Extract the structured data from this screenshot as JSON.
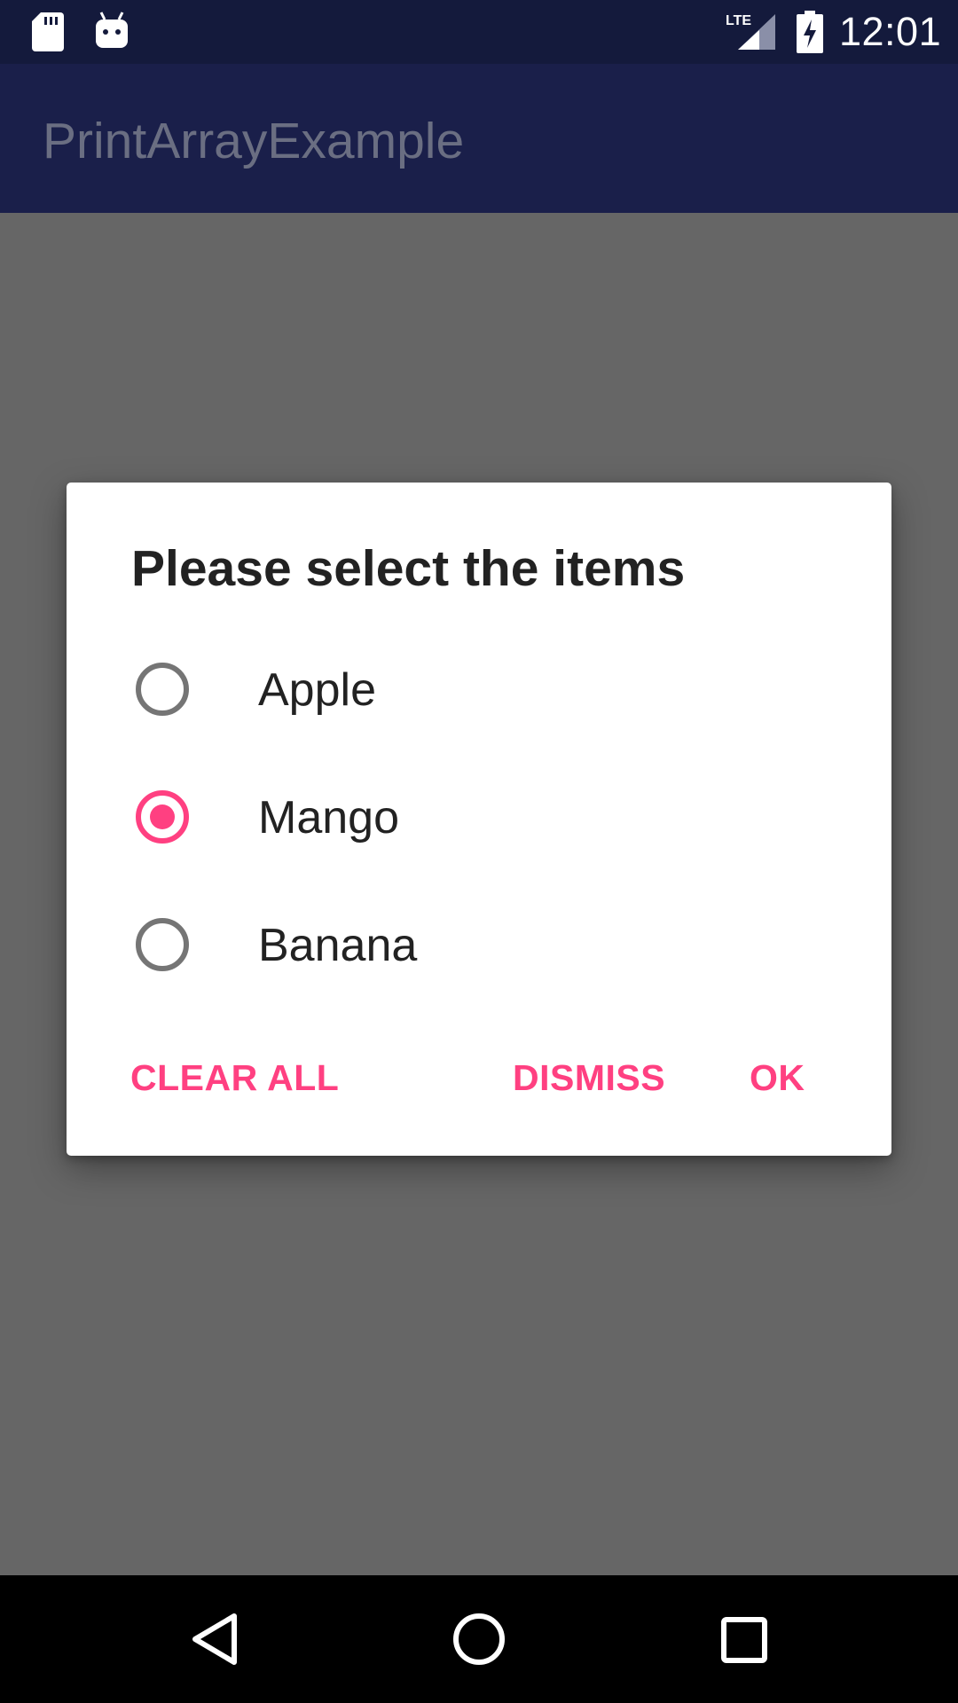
{
  "status_bar": {
    "time": "12:01",
    "network_label": "LTE",
    "icons": [
      "sd-card-icon",
      "android-icon",
      "lte-signal-icon",
      "battery-charging-icon"
    ]
  },
  "app_bar": {
    "title": "PrintArrayExample"
  },
  "dialog": {
    "title": "Please select the items",
    "options": [
      {
        "label": "Apple",
        "checked": false
      },
      {
        "label": "Mango",
        "checked": true
      },
      {
        "label": "Banana",
        "checked": false
      }
    ],
    "buttons": {
      "clear_all": "CLEAR ALL",
      "dismiss": "DISMISS",
      "ok": "OK"
    }
  },
  "colors": {
    "accent": "#ff4081",
    "status_bar": "#141a3c",
    "app_bar": "#1a1f4a",
    "scrim": "#666666"
  },
  "nav_bar": {
    "icons": [
      "back-icon",
      "home-icon",
      "recents-icon"
    ]
  }
}
